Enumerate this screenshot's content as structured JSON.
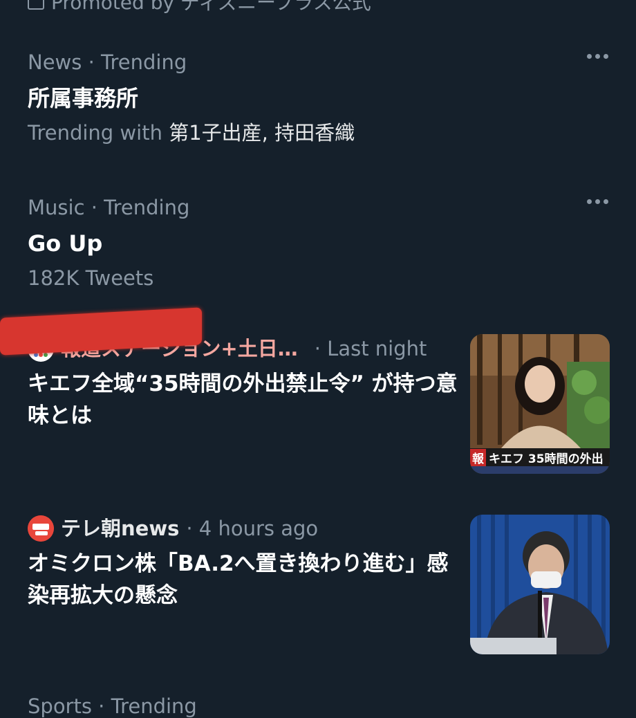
{
  "promoted": {
    "label": "Promoted by ディズニープラス公式"
  },
  "trends": [
    {
      "meta": "News · Trending",
      "title": "所属事務所",
      "sub_prefix": "Trending with",
      "sub_names": "第1子出産, 持田香織"
    },
    {
      "meta": "Music · Trending",
      "title": "Go Up",
      "sub": "182K Tweets"
    }
  ],
  "news": [
    {
      "source": "報道ステーション+土日…",
      "time": "· Last night",
      "headline": "キエフ全域“35時間の外出禁止令” が持つ意味とは",
      "thumb_caption_badge": "報",
      "thumb_caption": "キエフ 35時間の外出"
    },
    {
      "source": "テレ朝news",
      "time": "· 4 hours ago",
      "headline": "オミクロン株「BA.2へ置き換わり進む」感染再拡大の懸念"
    }
  ],
  "next_trend": {
    "meta": "Sports · Trending"
  }
}
